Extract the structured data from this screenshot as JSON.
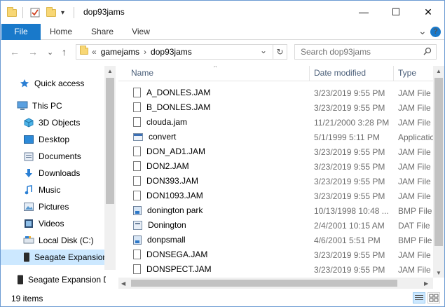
{
  "window": {
    "title": "dop93jams",
    "minimize": "—",
    "maximize": "☐",
    "close": "✕"
  },
  "ribbon": {
    "tabs": [
      "File",
      "Home",
      "Share",
      "View"
    ],
    "expand": "⌄",
    "help": "?"
  },
  "nav": {
    "back": "←",
    "forward": "→",
    "recent": "⌄",
    "up": "↑",
    "overflow": "«",
    "crumbs": [
      "gamejams",
      "dop93jams"
    ],
    "sep": "›",
    "dropdown": "⌄",
    "refresh": "↻",
    "search_placeholder": "Search dop93jams",
    "search_icon": "search-icon"
  },
  "sidebar": {
    "items": [
      {
        "label": "Quick access",
        "icon": "star-icon"
      },
      {
        "label": "This PC",
        "icon": "computer-icon"
      },
      {
        "label": "3D Objects",
        "icon": "cube-icon"
      },
      {
        "label": "Desktop",
        "icon": "desktop-icon"
      },
      {
        "label": "Documents",
        "icon": "documents-icon"
      },
      {
        "label": "Downloads",
        "icon": "download-icon"
      },
      {
        "label": "Music",
        "icon": "music-icon"
      },
      {
        "label": "Pictures",
        "icon": "pictures-icon"
      },
      {
        "label": "Videos",
        "icon": "videos-icon"
      },
      {
        "label": "Local Disk (C:)",
        "icon": "drive-icon"
      },
      {
        "label": "Seagate Expansion",
        "icon": "external-drive-icon"
      },
      {
        "label": "Seagate Expansion D",
        "icon": "external-drive-icon"
      }
    ]
  },
  "columns": {
    "name": "Name",
    "date": "Date modified",
    "type": "Type"
  },
  "files": [
    {
      "name": "A_DONLES.JAM",
      "date": "3/23/2019 9:55 PM",
      "type": "JAM File",
      "icon": "doc"
    },
    {
      "name": "B_DONLES.JAM",
      "date": "3/23/2019 9:55 PM",
      "type": "JAM File",
      "icon": "doc"
    },
    {
      "name": "clouda.jam",
      "date": "11/21/2000 3:28 PM",
      "type": "JAM File",
      "icon": "doc"
    },
    {
      "name": "convert",
      "date": "5/1/1999 5:11 PM",
      "type": "Applicatio",
      "icon": "app"
    },
    {
      "name": "DON_AD1.JAM",
      "date": "3/23/2019 9:55 PM",
      "type": "JAM File",
      "icon": "doc"
    },
    {
      "name": "DON2.JAM",
      "date": "3/23/2019 9:55 PM",
      "type": "JAM File",
      "icon": "doc"
    },
    {
      "name": "DON393.JAM",
      "date": "3/23/2019 9:55 PM",
      "type": "JAM File",
      "icon": "doc"
    },
    {
      "name": "DON1093.JAM",
      "date": "3/23/2019 9:55 PM",
      "type": "JAM File",
      "icon": "doc"
    },
    {
      "name": "donington park",
      "date": "10/13/1998 10:48 ...",
      "type": "BMP File",
      "icon": "bmp"
    },
    {
      "name": "Donington",
      "date": "2/4/2001 10:15 AM",
      "type": "DAT File",
      "icon": "dat"
    },
    {
      "name": "donpsmall",
      "date": "4/6/2001 5:51 PM",
      "type": "BMP File",
      "icon": "bmp"
    },
    {
      "name": "DONSEGA.JAM",
      "date": "3/23/2019 9:55 PM",
      "type": "JAM File",
      "icon": "doc"
    },
    {
      "name": "DONSPECT.JAM",
      "date": "3/23/2019 9:55 PM",
      "type": "JAM File",
      "icon": "doc"
    }
  ],
  "status": {
    "count": "19 items"
  },
  "colors": {
    "accent": "#1979ca",
    "selected": "#cce8ff",
    "header_text": "#4c607a",
    "meta_text": "#6d6d6d"
  }
}
